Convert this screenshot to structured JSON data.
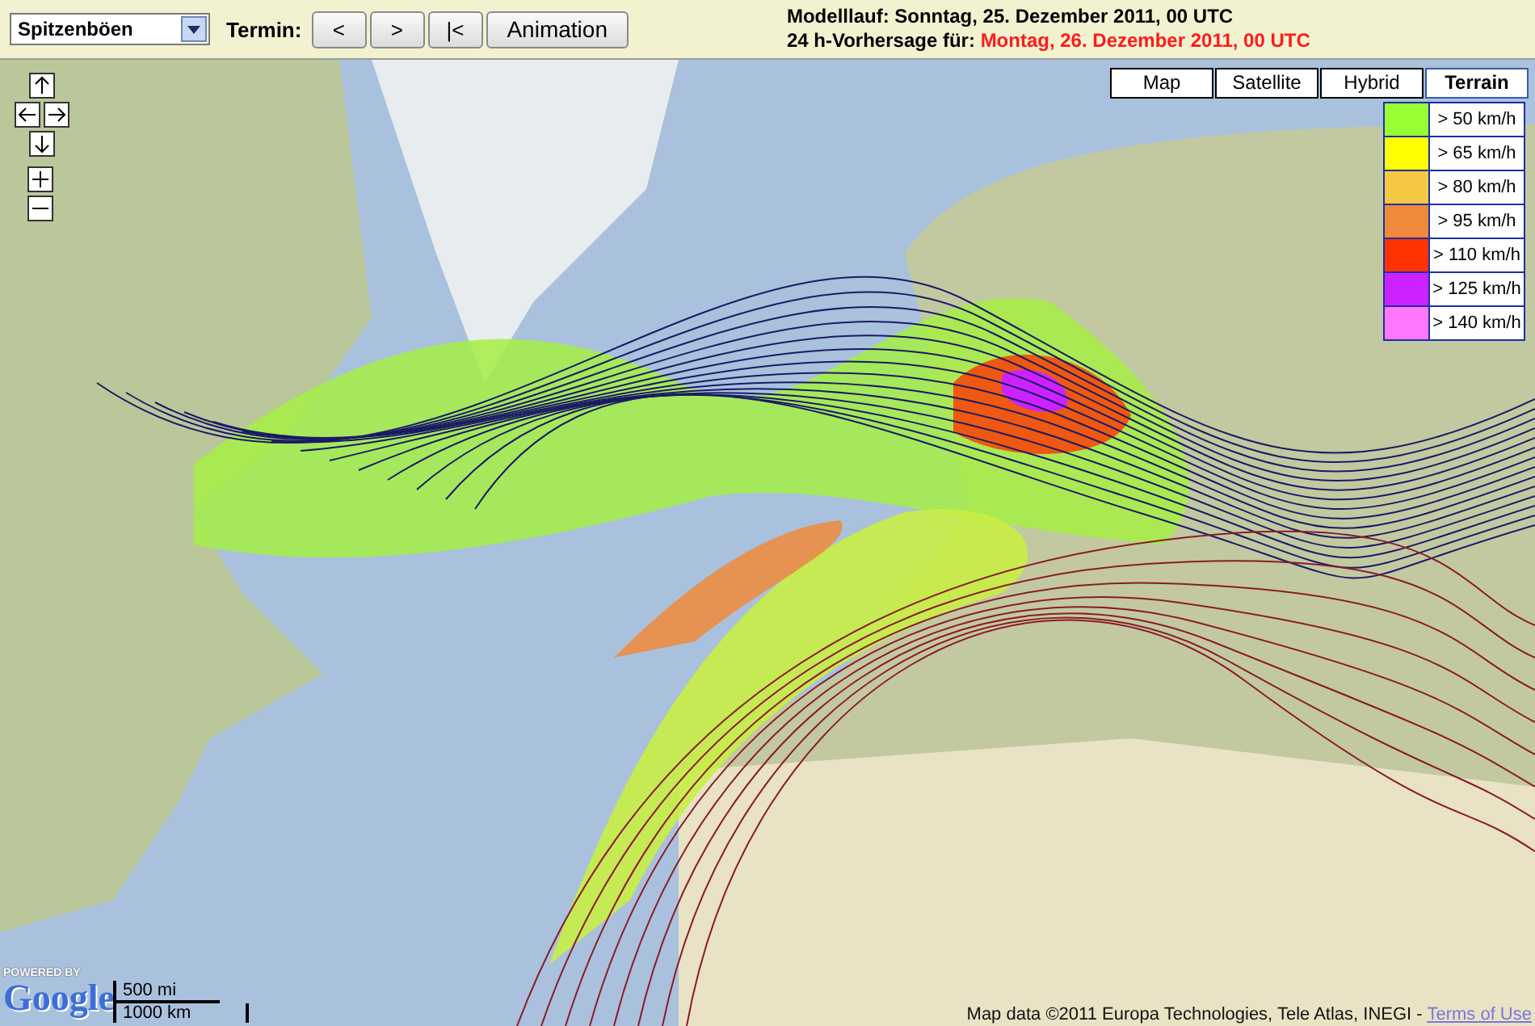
{
  "toolbar": {
    "product_select": {
      "value": "Spitzenböen"
    },
    "termin_label": "Termin:",
    "buttons": [
      {
        "label": "<"
      },
      {
        "label": ">"
      },
      {
        "label": "|<"
      },
      {
        "label": "Animation"
      }
    ],
    "model_run": "Modelllauf: Sonntag, 25. Dezember 2011, 00 UTC",
    "forecast_label": "24 h-Vorhersage für:",
    "forecast_date": "Montag, 26. Dezember 2011, 00 UTC"
  },
  "map": {
    "map_types": [
      {
        "label": "Map",
        "selected": false
      },
      {
        "label": "Satellite",
        "selected": false
      },
      {
        "label": "Hybrid",
        "selected": false
      },
      {
        "label": "Terrain",
        "selected": true
      }
    ],
    "legend": [
      {
        "label": "> 50 km/h",
        "color": "#99ff33"
      },
      {
        "label": "> 65 km/h",
        "color": "#ffff00"
      },
      {
        "label": "> 80 km/h",
        "color": "#f5c842"
      },
      {
        "label": "> 95 km/h",
        "color": "#f08a3a"
      },
      {
        "label": "> 110 km/h",
        "color": "#ff3300"
      },
      {
        "label": "> 125 km/h",
        "color": "#cc22ff"
      },
      {
        "label": "> 140 km/h",
        "color": "#ff77ff"
      }
    ],
    "logo_caption": "POWERED BY",
    "logo": "Google",
    "scale": {
      "miles": "500 mi",
      "km": "1000 km"
    },
    "attribution": "Map data ©2011 Europa Technologies, Tele Atlas, INEGI - ",
    "terms_link": "Terms of Use"
  }
}
